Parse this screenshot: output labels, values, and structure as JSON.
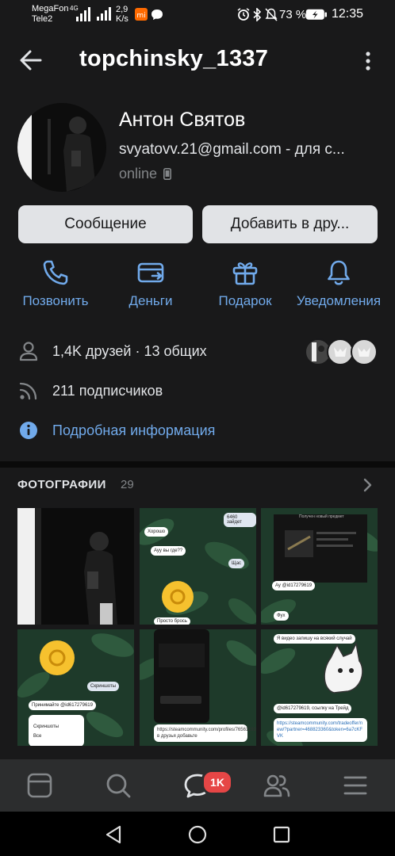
{
  "status_bar": {
    "carrier1": "MegaFon",
    "carrier2": "Tele2",
    "net1": "4G",
    "speed_value": "2,9",
    "speed_unit": "K/s",
    "battery": "73 %",
    "time": "12:35"
  },
  "header": {
    "title": "topchinsky_1337"
  },
  "profile": {
    "name": "Антон Святов",
    "status": "svyatovv.21@gmail.com - для с...",
    "online": "online"
  },
  "buttons": {
    "message": "Сообщение",
    "add_friend": "Добавить в дру..."
  },
  "actions": [
    {
      "label": "Позвонить",
      "icon": "phone-icon"
    },
    {
      "label": "Деньги",
      "icon": "money-transfer-icon"
    },
    {
      "label": "Подарок",
      "icon": "gift-icon"
    },
    {
      "label": "Уведомления",
      "icon": "bell-icon"
    }
  ],
  "info": {
    "friends": "1,4K друзей · 13 общих",
    "followers": "211 подписчиков",
    "details": "Подробная информация"
  },
  "photos": {
    "title": "ФОТОГРАФИИ",
    "count": "29",
    "thumbs": [
      {
        "texts": []
      },
      {
        "texts": [
          "6460 зайдет",
          "Хорошо",
          "Ауу вы где??",
          "Щас",
          "Просто брось"
        ]
      },
      {
        "texts": [
          "Получен новый предмет",
          "Ау @id17279619",
          "Фух"
        ]
      },
      {
        "texts": [
          "Скриншоты",
          "Принимайте @id617279619",
          "Скриншоты",
          "Все"
        ]
      },
      {
        "texts": [
          "https://steamcommunity.com/profiles/76561199077785/ в друзья добавьте"
        ]
      },
      {
        "texts": [
          "Я видео запишу на всякий случай",
          "@id617279619, ссылку на Трейд",
          "https://steamcommunity.com/tradeoffer/new/?partner=468823360&token=6a7cKFVK"
        ]
      }
    ]
  },
  "tabbar": {
    "badge": "1K",
    "tabs": [
      "newsfeed-icon",
      "search-icon",
      "messages-icon",
      "friends-icon",
      "menu-icon"
    ]
  },
  "colors": {
    "background": "#19191a",
    "accent": "#71aaeb",
    "button": "#e1e3e6",
    "badge": "#e64646"
  }
}
